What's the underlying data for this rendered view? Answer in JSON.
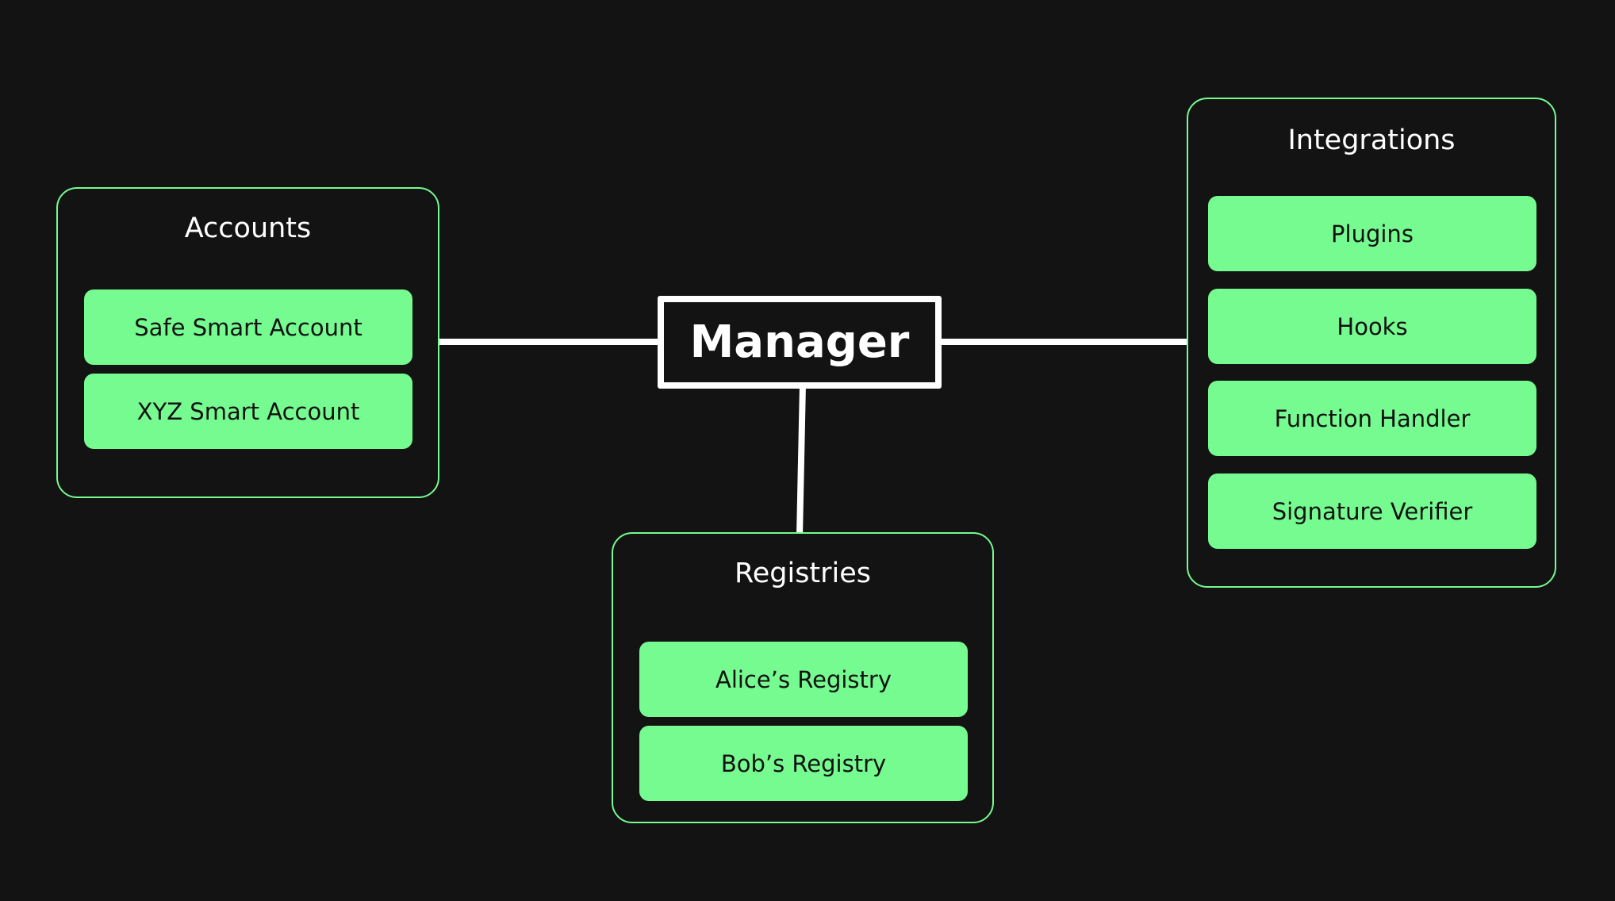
{
  "manager": {
    "label": "Manager"
  },
  "accounts": {
    "title": "Accounts",
    "items": [
      "Safe Smart Account",
      "XYZ Smart Account"
    ]
  },
  "integrations": {
    "title": "Integrations",
    "items": [
      "Plugins",
      "Hooks",
      "Function Handler",
      "Signature Verifier"
    ]
  },
  "registries": {
    "title": "Registries",
    "items": [
      "Alice’s Registry",
      "Bob’s Registry"
    ]
  },
  "colors": {
    "background": "#131313",
    "accent": "#75fb8f",
    "line": "#ffffff"
  }
}
